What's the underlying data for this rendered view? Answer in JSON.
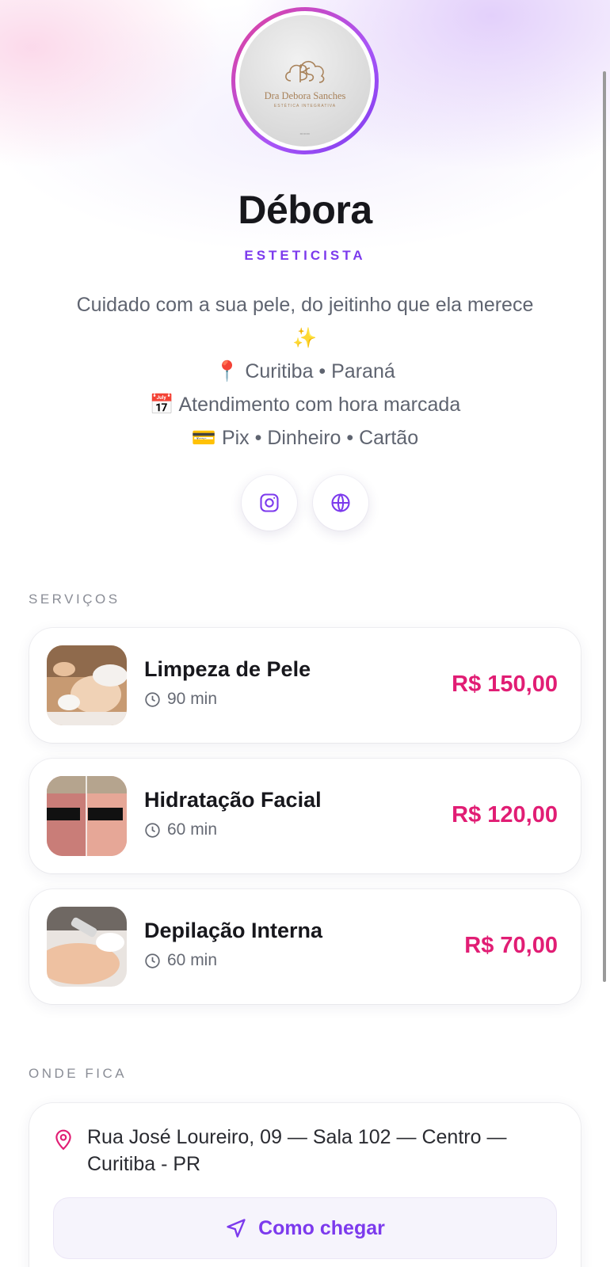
{
  "profile": {
    "logo_name": "Dra Debora Sanches",
    "logo_sub": "ESTÉTICA INTEGRATIVA",
    "name": "Débora",
    "role": "ESTETICISTA",
    "bio": [
      {
        "emoji": "",
        "text": "Cuidado com a sua pele, do jeitinho que ela merece"
      },
      {
        "emoji": "✨",
        "text": ""
      },
      {
        "emoji": "📍",
        "text": "Curitiba • Paraná"
      },
      {
        "emoji": "📅",
        "text": "Atendimento com hora marcada"
      },
      {
        "emoji": "💳",
        "text": "Pix • Dinheiro • Cartão"
      }
    ]
  },
  "social": [
    {
      "icon": "instagram-icon"
    },
    {
      "icon": "globe-icon"
    }
  ],
  "services": {
    "label": "SERVIÇOS",
    "items": [
      {
        "name": "Limpeza de Pele",
        "duration": "90 min",
        "price": "R$ 150,00"
      },
      {
        "name": "Hidratação Facial",
        "duration": "60 min",
        "price": "R$ 120,00"
      },
      {
        "name": "Depilação Interna",
        "duration": "60 min",
        "price": "R$ 70,00"
      }
    ]
  },
  "location": {
    "label": "ONDE FICA",
    "address": "Rua José Loureiro, 09 — Sala 102 — Centro — Curitiba - PR",
    "directions_label": "Como chegar"
  },
  "colors": {
    "accent": "#7c3aed",
    "price": "#e11d74",
    "ring_start": "#e2409a",
    "ring_end": "#7c3aed"
  }
}
